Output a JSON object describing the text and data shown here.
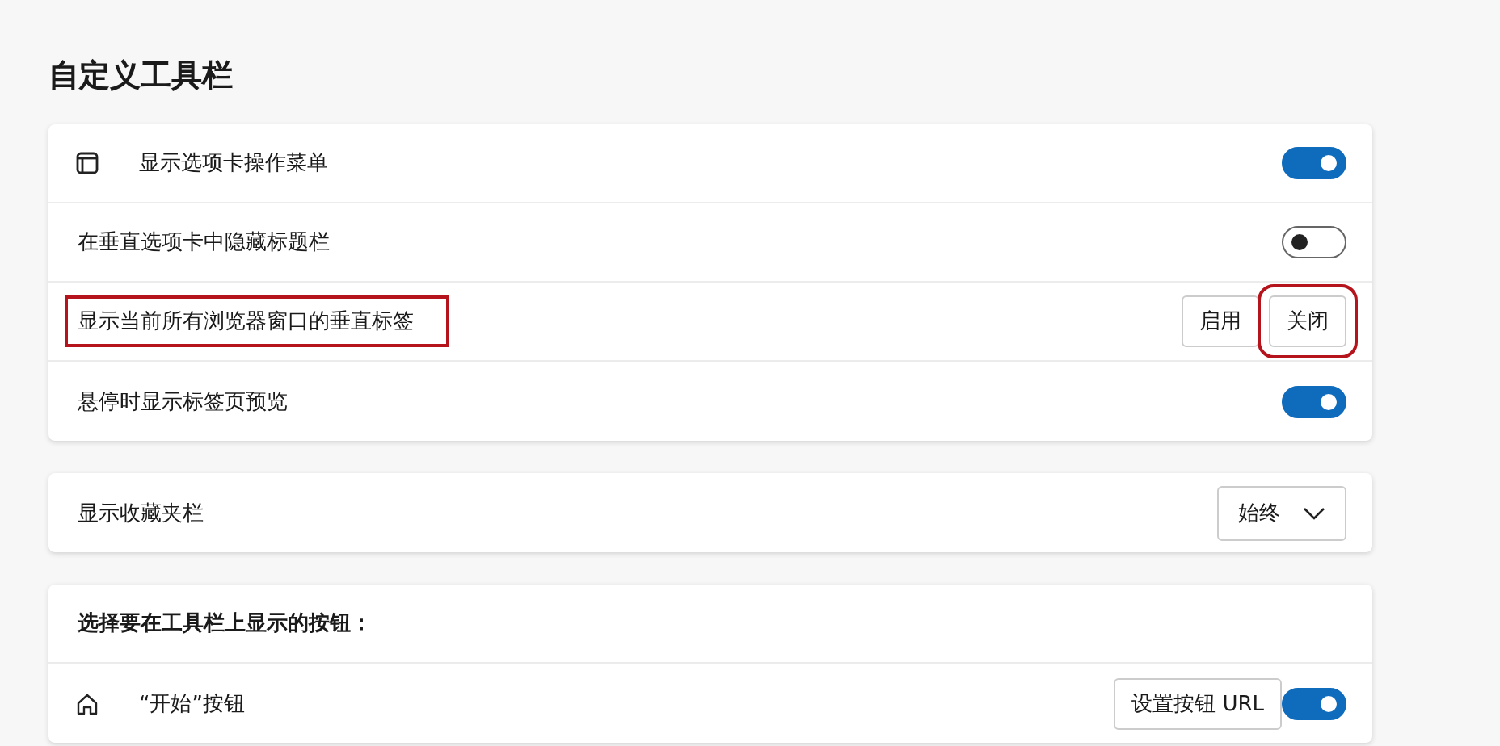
{
  "title": "自定义工具栏",
  "cards": [
    {
      "rows": [
        {
          "kind": "toggle",
          "label": "显示选项卡操作菜单",
          "on": true,
          "highlighted": false
        },
        {
          "kind": "toggle",
          "label": "在垂直选项卡中隐藏标题栏",
          "on": false,
          "highlighted": false
        },
        {
          "kind": "buttons",
          "label": "显示当前所有浏览器窗口的垂直标签",
          "highlighted": true,
          "buttons": [
            {
              "label": "启用",
              "highlighted": false
            },
            {
              "label": "关闭",
              "highlighted": true
            }
          ]
        },
        {
          "kind": "toggle",
          "label": "悬停时显示标签页预览",
          "on": true,
          "highlighted": false
        }
      ]
    },
    {
      "rows": [
        {
          "kind": "select",
          "label": "显示收藏夹栏",
          "value": "始终",
          "highlighted": false
        }
      ]
    },
    {
      "rows": [
        {
          "kind": "header",
          "label": "选择要在工具栏上显示的按钮：",
          "highlighted": false
        },
        {
          "kind": "toggle",
          "label": "“开始”按钮",
          "button": "设置按钮 URL",
          "on": true,
          "highlighted": false
        }
      ]
    }
  ]
}
